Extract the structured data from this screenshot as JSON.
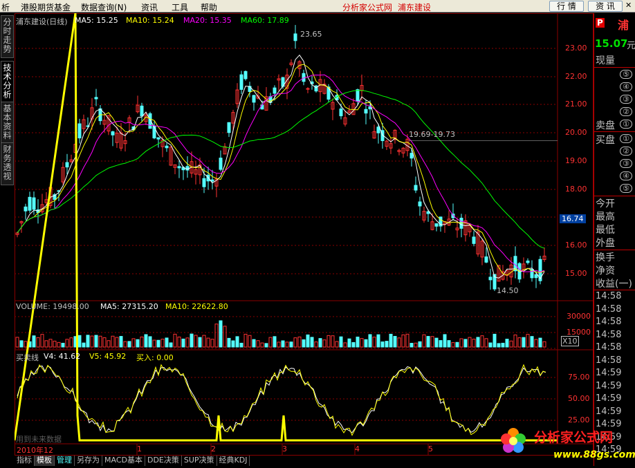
{
  "menu": {
    "items": [
      "析",
      "港股期货基金",
      "数据查询(N)",
      "资讯",
      "工具",
      "帮助"
    ],
    "app_title": "分析家公式网",
    "stock_title": "浦东建设",
    "btn_quote": "行 情",
    "btn_info": "资 讯"
  },
  "left_tabs": [
    "分时走势",
    "技术分析",
    "基本资料",
    "财务透视"
  ],
  "main_chart": {
    "title": "浦东建设(日线)",
    "ma5": "MA5: 15.25",
    "ma10": "MA10: 15.24",
    "ma20": "MA20: 15.35",
    "ma60": "MA60: 17.89",
    "y_ticks": [
      "23.00",
      "22.00",
      "21.00",
      "20.00",
      "19.00",
      "18.00",
      "16.00",
      "15.00"
    ],
    "current_price_tag": "16.74",
    "high_annotation": "23.65",
    "low_annotation": "14.50",
    "gap_annotation": "19.69-19.73"
  },
  "volume_chart": {
    "label": "VOLUME: 19498.00",
    "ma5": "MA5: 27315.20",
    "ma10": "MA10: 22622.80",
    "y_ticks": [
      "30000",
      "15000"
    ],
    "unit": "X10"
  },
  "indicator_chart": {
    "name": "买卖线",
    "v4": "V4: 41.62",
    "v5": "V5: 45.92",
    "buy": "买入: 0.00",
    "y_ticks": [
      "75.00",
      "50.00",
      "25.00"
    ],
    "watermark": "用到未来数据"
  },
  "time_axis": {
    "start": "2010年12",
    "months": [
      "1",
      "2",
      "3",
      "4",
      "5"
    ]
  },
  "right_panel": {
    "badge": "P",
    "stock_short": "浦",
    "price": "15.07",
    "unit": "元",
    "xianliang": "现量",
    "sell_label": "卖盘",
    "buy_label": "买盘",
    "levels": [
      "⑤",
      "④",
      "③",
      "②",
      "①"
    ],
    "today_open": "今开",
    "high": "最高",
    "low": "最低",
    "outer": "外盘",
    "turnover": "换手",
    "net_asset": "净资",
    "earnings": "收益(一)",
    "times": [
      "14:58",
      "14:58",
      "14:58",
      "14:58",
      "14:58",
      "14:58",
      "14:59",
      "14:59",
      "14:59",
      "14:59",
      "14:59",
      "14:59",
      "14:59"
    ]
  },
  "bottom_tabs": [
    "指标",
    "模板",
    "管理",
    "另存为",
    "MACD基本",
    "DDE决策",
    "SUP决策",
    "经典KDJ"
  ],
  "logo": {
    "text": "分析家公式网",
    "url": "www.88gs.com"
  },
  "colors": {
    "up": "#ff3232",
    "down": "#54ffff",
    "ma5": "#ffffff",
    "ma10": "#ffff00",
    "ma20": "#ff00ff",
    "ma60": "#00ff00",
    "grid": "#8b0000"
  }
}
